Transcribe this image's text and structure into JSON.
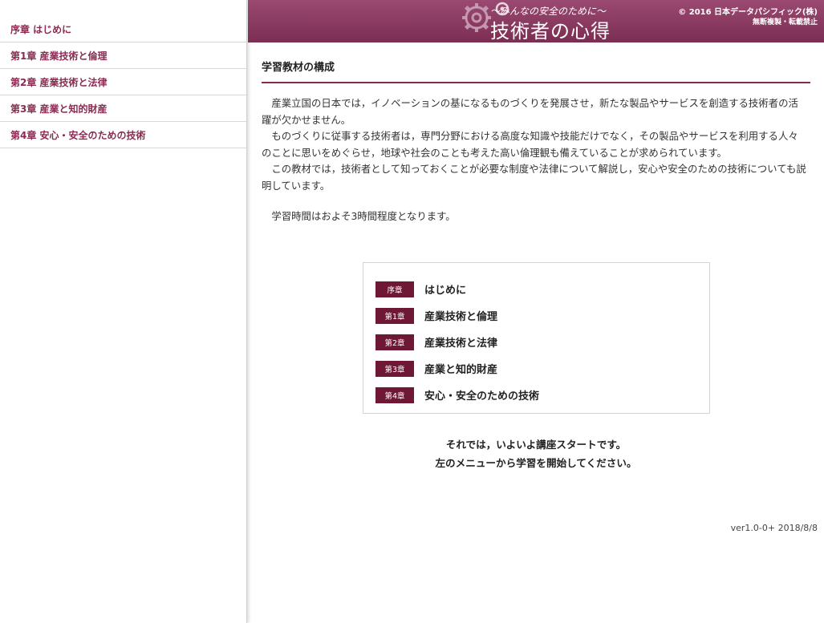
{
  "sidebar": {
    "items": [
      {
        "label": "序章 はじめに"
      },
      {
        "label": "第1章 産業技術と倫理"
      },
      {
        "label": "第2章 産業技術と法律"
      },
      {
        "label": "第3章 産業と知的財産"
      },
      {
        "label": "第4章 安心・安全のための技術"
      }
    ]
  },
  "header": {
    "logo_subtitle": "〜みんなの安全のために〜",
    "logo_title": "技術者の心得",
    "copyright": "© 2016 日本データパシフィック(株)",
    "copyright_note": "無断複製・転載禁止"
  },
  "main": {
    "section_title": "学習教材の構成",
    "paragraphs": [
      "産業立国の日本では，イノベーションの基になるものづくりを発展させ，新たな製品やサービスを創造する技術者の活躍が欠かせません。",
      "ものづくりに従事する技術者は，専門分野における高度な知識や技能だけでなく，その製品やサービスを利用する人々のことに思いをめぐらせ，地球や社会のことも考えた高い倫理観も備えていることが求められています。",
      "この教材では，技術者として知っておくことが必要な制度や法律について解説し，安心や安全のための技術についても説明しています。"
    ],
    "study_time": "学習時間はおよそ3時間程度となります。",
    "toc": [
      {
        "badge": "序章",
        "label": "はじめに"
      },
      {
        "badge": "第1章",
        "label": "産業技術と倫理"
      },
      {
        "badge": "第2章",
        "label": "産業技術と法律"
      },
      {
        "badge": "第3章",
        "label": "産業と知的財産"
      },
      {
        "badge": "第4章",
        "label": "安心・安全のための技術"
      }
    ],
    "closing_line1": "それでは，いよいよ講座スタートです。",
    "closing_line2": "左のメニューから学習を開始してください。",
    "version": "ver1.0-0+ 2018/8/8"
  },
  "colors": {
    "accent": "#8a2a52",
    "header_bg": "#8a3a60",
    "badge_bg": "#6e1836"
  }
}
